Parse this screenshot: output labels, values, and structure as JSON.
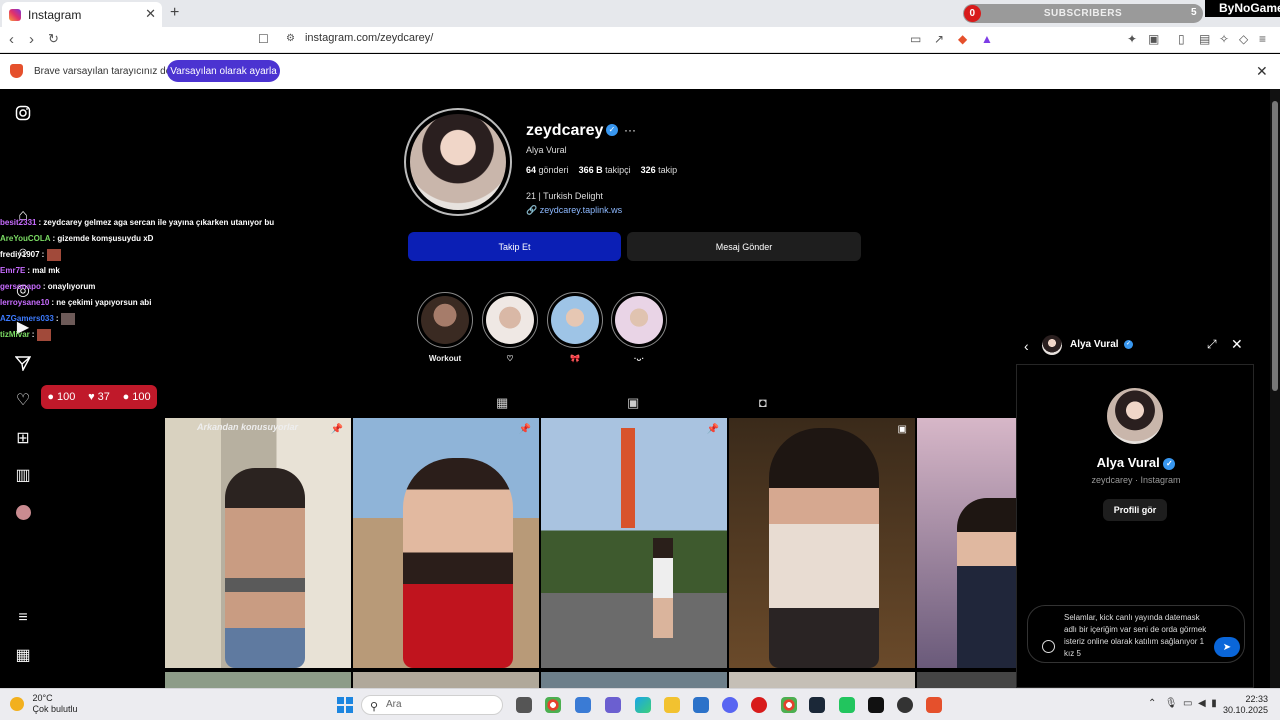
{
  "browser": {
    "tab_title": "Instagram",
    "new_tab": "+",
    "url": "instagram.com/zeydcarey/",
    "infobar_message": "Brave varsayılan tarayıcınız değil",
    "infobar_button": "Varsayılan olarak ayarla"
  },
  "stream_overlay": {
    "subscribers_label": "SUBSCRIBERS",
    "subscribers_count": "0",
    "subscribers_goal": "5",
    "brand": "ByNoGame",
    "chat": [
      {
        "user": "besit2331",
        "msg": ": zeydcarey gelmez aga sercan ile yayına çıkarken utanıyor bu",
        "color": "#c86cff"
      },
      {
        "user": "AreYouCOLA",
        "msg": ": gizemde komşusuydu xD",
        "color": "#7bdc64"
      },
      {
        "user": "frediy1907",
        "msg": ":",
        "color": "#ffffff"
      },
      {
        "user": "Emr7E",
        "msg": ": mal mk",
        "color": "#c86cff"
      },
      {
        "user": "gersonapo",
        "msg": ": onaylıyorum",
        "color": "#c86cff"
      },
      {
        "user": "lerroysane10",
        "msg": ": ne çekimi yapıyorsun abi",
        "color": "#c86cff"
      },
      {
        "user": "AZGamers033",
        "msg": ":",
        "color": "#3d7bff"
      },
      {
        "user": "tizMivar",
        "msg": ":",
        "color": "#7bdc64"
      }
    ],
    "stats": {
      "chat": "100",
      "likes": "37",
      "viewers": "100"
    }
  },
  "profile": {
    "username": "zeydcarey",
    "full_name": "Alya Vural",
    "posts_count": "64",
    "posts_label": "gönderi",
    "followers_count": "366 B",
    "followers_label": "takipçi",
    "following_count": "326",
    "following_label": "takip",
    "bio": "21 | Turkish Delight",
    "link": "zeydcarey.taplink.ws",
    "follow_button": "Takip Et",
    "message_button": "Mesaj Gönder",
    "highlights": [
      {
        "label": "Workout"
      },
      {
        "label": "♡"
      },
      {
        "label": "🎀"
      },
      {
        "label": "·ᴗ·"
      }
    ],
    "posts": [
      {
        "caption": "Arkandan konusuyorlar"
      }
    ]
  },
  "dm": {
    "name": "Alya Vural",
    "subtitle": "zeydcarey · Instagram",
    "profile_button": "Profili gör",
    "draft": "Selamlar, kick canlı yayında datemask adlı bir içeriğim var seni de orda görmek isteriz online olarak katılım sağlanıyor 1 kız 5"
  },
  "taskbar": {
    "temperature": "20°C",
    "weather": "Çok bulutlu",
    "search_placeholder": "Ara",
    "time": "22:33",
    "date": "30.10.2025"
  }
}
